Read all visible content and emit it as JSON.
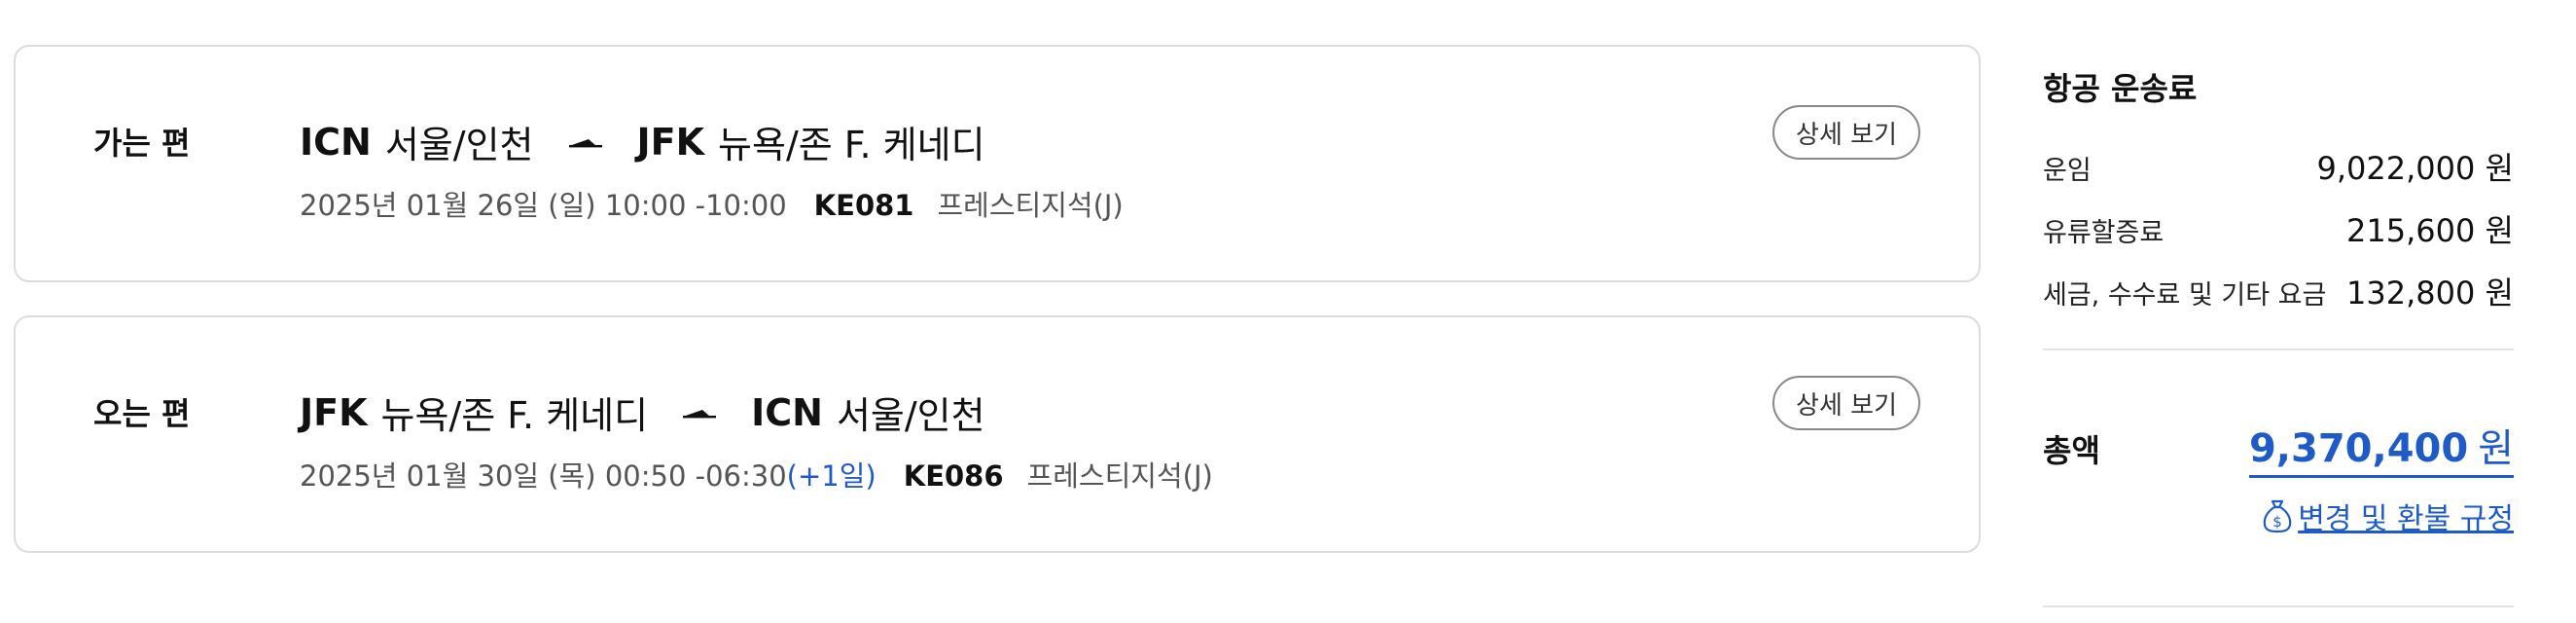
{
  "outbound": {
    "direction_label": "가는 편",
    "origin_code": "ICN",
    "origin_city": "서울/인천",
    "dest_code": "JFK",
    "dest_city": "뉴욕/존 F. 케네디",
    "date_time": "2025년 01월 26일 (일) 10:00 -10:00",
    "plus_day": "",
    "flight_no": "KE081",
    "cabin": "프레스티지석(J)",
    "detail_label": "상세 보기"
  },
  "inbound": {
    "direction_label": "오는 편",
    "origin_code": "JFK",
    "origin_city": "뉴욕/존 F. 케네디",
    "dest_code": "ICN",
    "dest_city": "서울/인천",
    "date_time": "2025년 01월 30일 (목) 00:50 -06:30",
    "plus_day": "(+1일)",
    "flight_no": "KE086",
    "cabin": "프레스티지석(J)",
    "detail_label": "상세 보기"
  },
  "fare_summary": {
    "title": "항공 운송료",
    "rows": [
      {
        "label": "운임",
        "amount": "9,022,000 원"
      },
      {
        "label": "유류할증료",
        "amount": "215,600 원"
      },
      {
        "label": "세금, 수수료 및 기타 요금",
        "amount": "132,800 원"
      }
    ],
    "total_label": "총액",
    "total_amount": "9,370,400",
    "total_unit": "원",
    "policy_link": "변경 및 환불 규정"
  },
  "colors": {
    "accent_blue": "#1f5bc8",
    "border": "#dcdcdc"
  },
  "icons": {
    "route_arrow": "plane-arrow-icon",
    "policy": "money-bag-icon"
  }
}
